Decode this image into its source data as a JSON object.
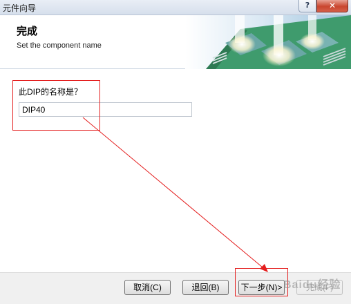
{
  "window": {
    "title": "元件向导",
    "help_label": "?",
    "close_label": "✕"
  },
  "header": {
    "title": "完成",
    "subtitle": "Set the component name"
  },
  "form": {
    "prompt": "此DIP的名称是？",
    "name_value": "DIP40"
  },
  "buttons": {
    "cancel": "取消(C)",
    "back": "退回(B)",
    "next": "下一步(N)>",
    "finish": "完成(F)"
  },
  "watermark": "Baidu经验",
  "colors": {
    "annotation": "#e41e1e",
    "footer_bg": "#f0f0f0",
    "banner_board": "#3f9b6d"
  }
}
